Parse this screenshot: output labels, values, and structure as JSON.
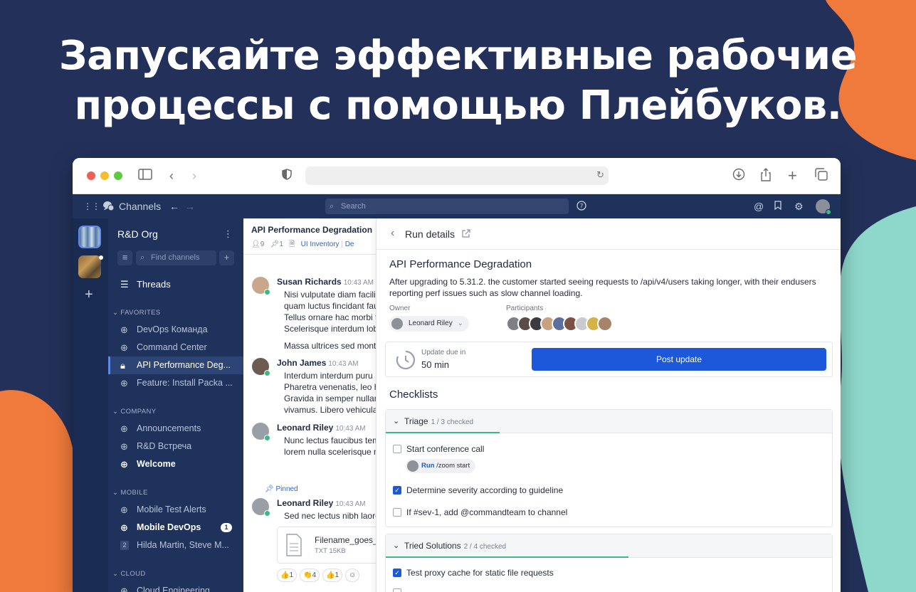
{
  "headline": {
    "line1": "Запускайте эффективные рабочие",
    "line2": "процессы с помощью Плейбуков."
  },
  "colors": {
    "background": "#23315a",
    "orange_blob": "#f07a3c",
    "teal_blob": "#8ed8cb",
    "sidebar": "#1e325c",
    "primary_button": "#1c58d9",
    "progress": "#3db887"
  },
  "topbar": {
    "product": "Channels",
    "search_placeholder": "Search"
  },
  "sidebar": {
    "team_name": "R&D Org",
    "find_placeholder": "Find channels",
    "threads": "Threads",
    "sections": [
      {
        "label": "FAVORITES",
        "items": [
          "DevOps Команда",
          "Command Center",
          "API Performance Deg...",
          "Feature: Install Packa ..."
        ]
      },
      {
        "label": "COMPANY",
        "items": [
          "Announcements",
          "R&D Встреча",
          "Welcome"
        ]
      },
      {
        "label": "MOBILE",
        "items": [
          "Mobile Test Alerts",
          "Mobile DevOps",
          "Hilda Martin, Steve M..."
        ]
      },
      {
        "label": "CLOUD",
        "items": [
          "Cloud Engineering"
        ]
      }
    ],
    "dm_count": "2",
    "unread_badge": "1"
  },
  "channel": {
    "title": "API Performance Degradation",
    "members": "9",
    "pinned_count": "1",
    "link1": "UI Inventory",
    "link2": "De",
    "posts": [
      {
        "author": "Susan Richards",
        "time": "10:43 AM",
        "lines": [
          "Nisi vulputate diam facili",
          "quam luctus fincidant fau",
          "Tellus ornare hac morbi t",
          "Scelerisque interdum lob"
        ],
        "extra": "Massa ultrices sed montu"
      },
      {
        "author": "John James",
        "time": "10:43 AM",
        "lines": [
          "Interdum interdum puru",
          "Pharetra venenatis, leo h",
          "Gravida in semper nullan",
          "vivamus. Libero vehicula"
        ]
      },
      {
        "author": "Leonard Riley",
        "time": "10:43 AM",
        "lines": [
          "Nunc lectus faucibus temp",
          "lorem nulla scelerisque ms"
        ]
      },
      {
        "author": "Leonard Riley",
        "time": "10:43 AM",
        "lines": [
          "Sed nec lectus nibh laoreet"
        ]
      }
    ],
    "pinned_label": "Pinned",
    "file": {
      "name": "Filename_goes_t",
      "meta": "TXT 15KB"
    },
    "reactions": [
      {
        "emoji": "👍",
        "count": "1"
      },
      {
        "emoji": "👏",
        "count": "4"
      },
      {
        "emoji": "👍",
        "count": "1"
      }
    ]
  },
  "run": {
    "header": "Run details",
    "title": "API Performance Degradation",
    "description": "After upgrading to 5.31.2. the customer started seeing requests to /api/v4/users taking longer, with their endusers reporting perf issues such as slow channel loading.",
    "owner_label": "Owner",
    "owner": "Leonard Riley",
    "participants_label": "Participants",
    "update_label": "Update due in",
    "update_value": "50 min",
    "post_update": "Post update",
    "checklists_label": "Checklists",
    "checklists": [
      {
        "name": "Triage",
        "count": "1 / 3 checked",
        "progress": 0.33,
        "items": [
          {
            "text": "Start conference call",
            "checked": false
          },
          {
            "text": "Determine severity according to guideline",
            "checked": true
          },
          {
            "text": "If #sev-1, add @commandteam to channel",
            "checked": false
          }
        ],
        "run_label": "Run",
        "run_cmd": "/zoom start"
      },
      {
        "name": "Tried Solutions",
        "count": "2 / 4 checked",
        "progress": 0.5,
        "items": [
          {
            "text": "Test proxy cache for static file requests",
            "checked": true
          }
        ]
      }
    ]
  }
}
